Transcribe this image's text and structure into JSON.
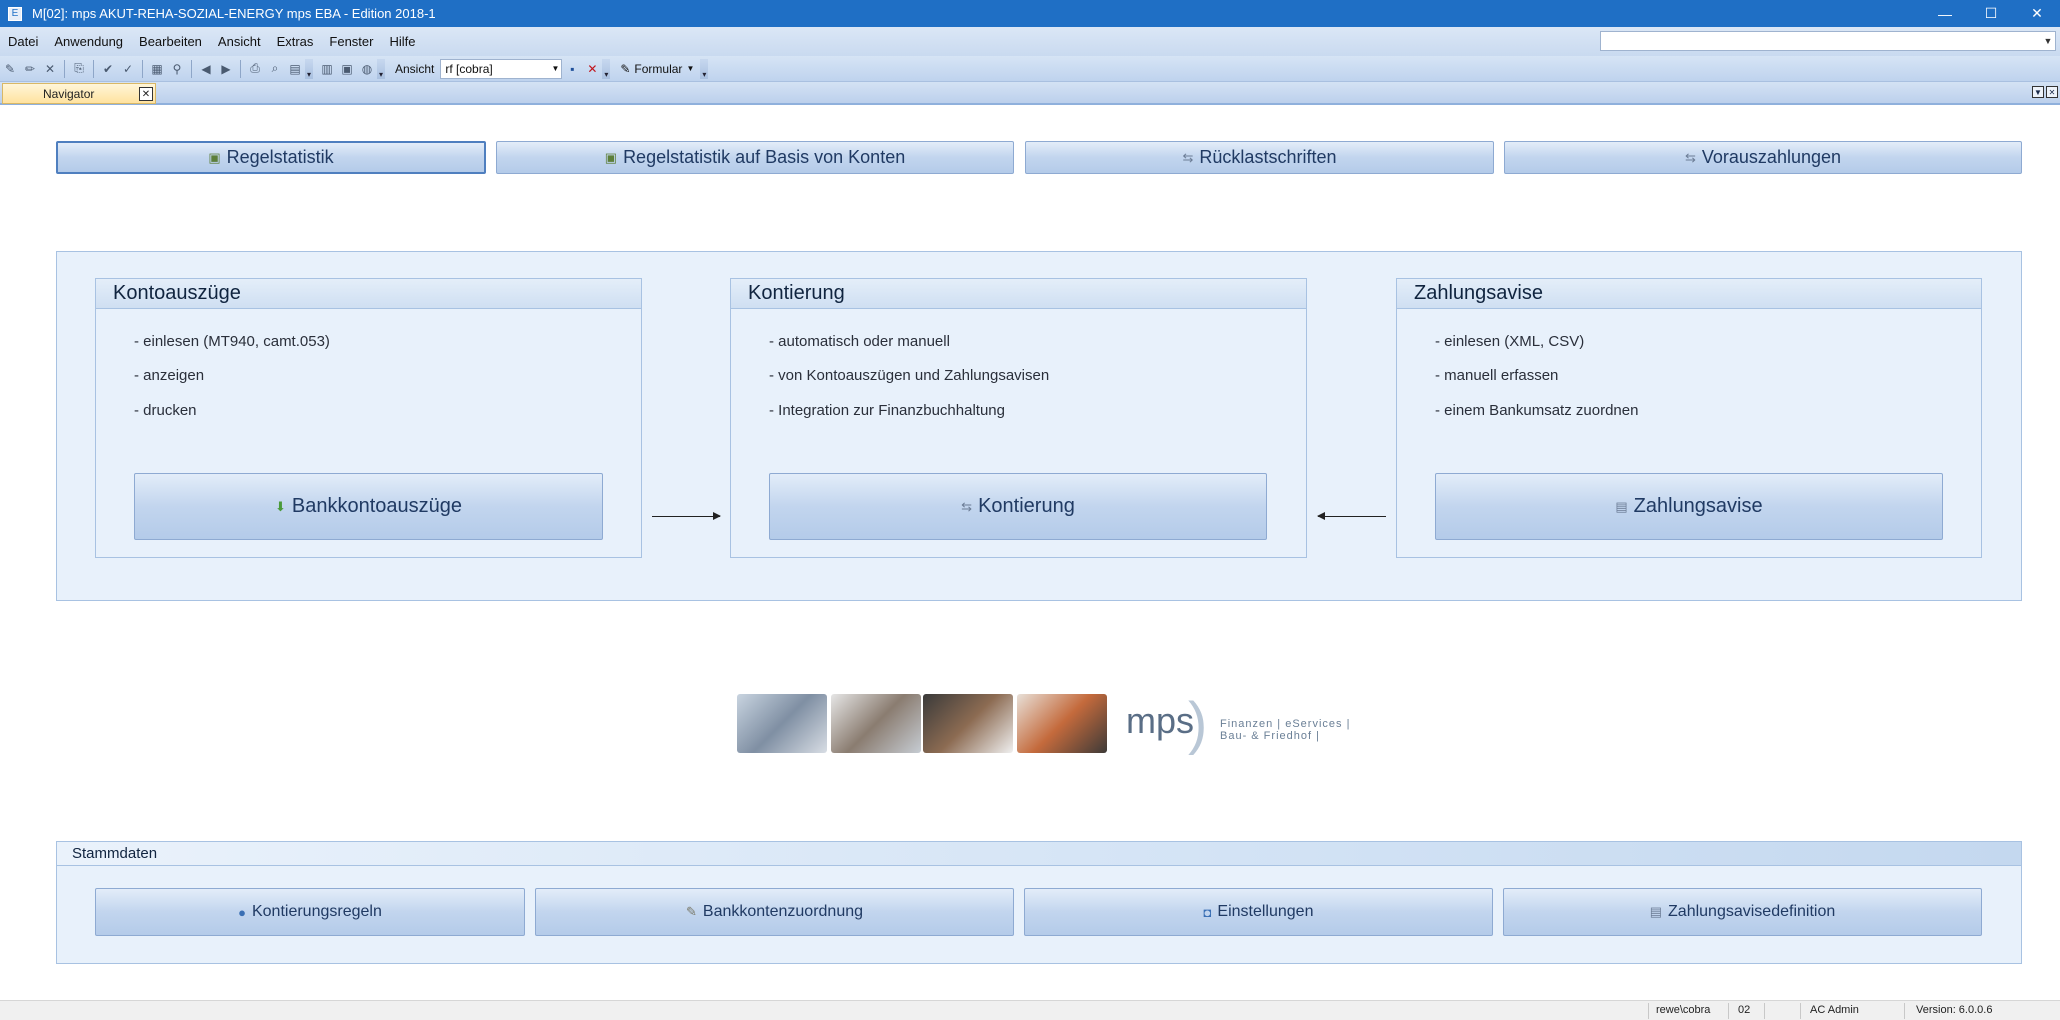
{
  "window": {
    "title": "M[02]: mps AKUT-REHA-SOZIAL-ENERGY mps EBA - Edition 2018-1",
    "controls": {
      "minimize": "—",
      "maximize": "☐",
      "close": "✕"
    }
  },
  "menu": {
    "items": [
      "Datei",
      "Anwendung",
      "Bearbeiten",
      "Ansicht",
      "Extras",
      "Fenster",
      "Hilfe"
    ],
    "search_value": ""
  },
  "toolbar": {
    "ansicht_label": "Ansicht",
    "ansicht_value": "rf [cobra]",
    "formular_label": "Formular"
  },
  "tabs": {
    "active": "Navigator"
  },
  "top_buttons": [
    {
      "label": "Regelstatistik",
      "icon": "chart-icon"
    },
    {
      "label": "Regelstatistik auf Basis von Konten",
      "icon": "chart-icon"
    },
    {
      "label": "Rücklastschriften",
      "icon": "transfer-icon"
    },
    {
      "label": "Vorauszahlungen",
      "icon": "transfer-icon"
    }
  ],
  "sections": {
    "kontoauszuege": {
      "title": "Kontoauszüge",
      "bullets": [
        "- einlesen (MT940, camt.053)",
        "- anzeigen",
        "- drucken"
      ],
      "button": "Bankkontoauszüge"
    },
    "kontierung": {
      "title": "Kontierung",
      "bullets": [
        "- automatisch oder manuell",
        "- von Kontoauszügen und Zahlungsavisen",
        "- Integration zur Finanzbuchhaltung"
      ],
      "button": "Kontierung"
    },
    "zahlungsavise": {
      "title": "Zahlungsavise",
      "bullets": [
        "- einlesen (XML, CSV)",
        "- manuell erfassen",
        "- einem Bankumsatz zuordnen"
      ],
      "button": "Zahlungsavise"
    }
  },
  "logo": {
    "brand": "mps",
    "line1": "Finanzen | eServices |",
    "line2": "Bau- & Friedhof |"
  },
  "stammdaten": {
    "title": "Stammdaten",
    "buttons": [
      "Kontierungsregeln",
      "Bankkontenzuordnung",
      "Einstellungen",
      "Zahlungsavisedefinition"
    ]
  },
  "status": {
    "path": "rewe\\cobra",
    "mandant": "02",
    "user": "AC Admin",
    "version": "Version: 6.0.0.6"
  },
  "colors": {
    "titlebar": "#1f6fc5",
    "panel_bg": "#e8f1fb",
    "tab_active": "#ffe3a0"
  }
}
